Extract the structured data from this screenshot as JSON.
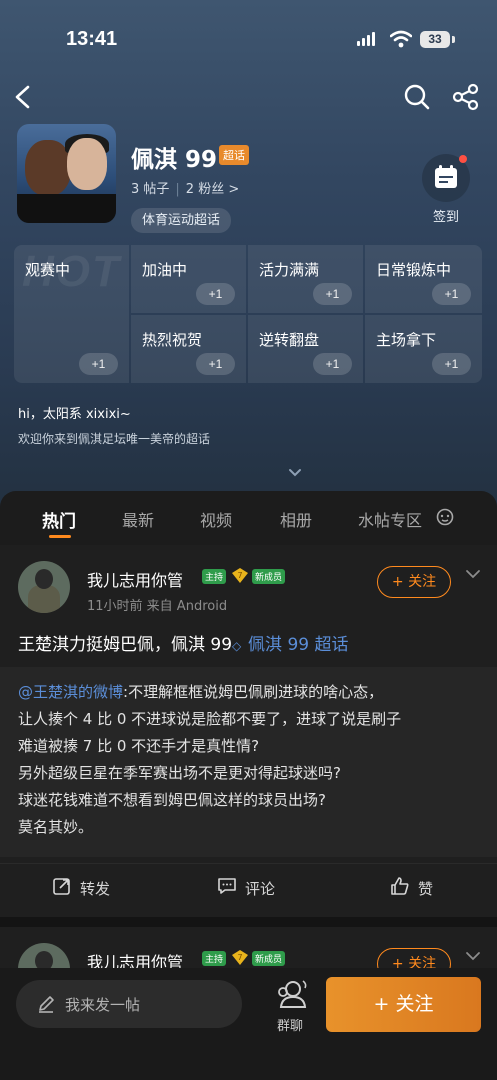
{
  "status_bar": {
    "time": "13:41",
    "battery": "33"
  },
  "header": {
    "title": "佩淇 99",
    "super_tag": "超话",
    "posts": "3 帖子",
    "fans": "2 粉丝 >",
    "category": "体育运动超话",
    "checkin_label": "签到"
  },
  "hot_grid": {
    "watermark": "HOT",
    "items": [
      {
        "label": "观赛中",
        "count": "+1"
      },
      {
        "label": "加油中",
        "count": "+1"
      },
      {
        "label": "活力满满",
        "count": "+1"
      },
      {
        "label": "日常锻炼中",
        "count": "+1"
      },
      {
        "label": "热烈祝贺",
        "count": "+1"
      },
      {
        "label": "逆转翻盘",
        "count": "+1"
      },
      {
        "label": "主场拿下",
        "count": "+1"
      }
    ]
  },
  "intro": {
    "greeting": "hi，太阳系 xixixi~",
    "welcome": "欢迎你来到佩淇足坛唯一美帝的超话"
  },
  "tabs": [
    "热门",
    "最新",
    "视频",
    "相册",
    "水帖专区"
  ],
  "post1": {
    "author": "我儿志用你管",
    "badge_host": "主持",
    "badge_new": "新成员",
    "meta": "11小时前   来自 Android",
    "follow": "+ 关注",
    "text_main": "王楚淇力挺姆巴佩，佩淇 99",
    "text_link": "佩淇 99 超话",
    "quote_mention": "@王楚淇的微博",
    "quote_lines": [
      ":不理解框框说姆巴佩刷进球的啥心态，",
      "让人揍个 4 比 0 不进球说是脸都不要了，进球了说是刷子",
      "难道被揍 7 比 0 不还手才是真性情?",
      "另外超级巨星在季军赛出场不是更对得起球迷吗?",
      "球迷花钱难道不想看到姆巴佩这样的球员出场?",
      "莫名其妙。"
    ],
    "actions": {
      "repost": "转发",
      "comment": "评论",
      "like": "赞"
    }
  },
  "post2": {
    "author": "我儿志用你管",
    "badge_host": "主持",
    "badge_new": "新成员",
    "follow": "+ 关注"
  },
  "bottom_bar": {
    "compose": "我来发一帖",
    "groupchat": "群聊",
    "follow": "+ 关注"
  },
  "colors": {
    "accent": "#ff8a1e",
    "link": "#5b8ed8",
    "badge_green": "#2f9c4b"
  },
  "icons": [
    "back-icon",
    "search-icon",
    "share-icon",
    "calendar-icon",
    "pencil-icon",
    "group-chat-icon"
  ]
}
